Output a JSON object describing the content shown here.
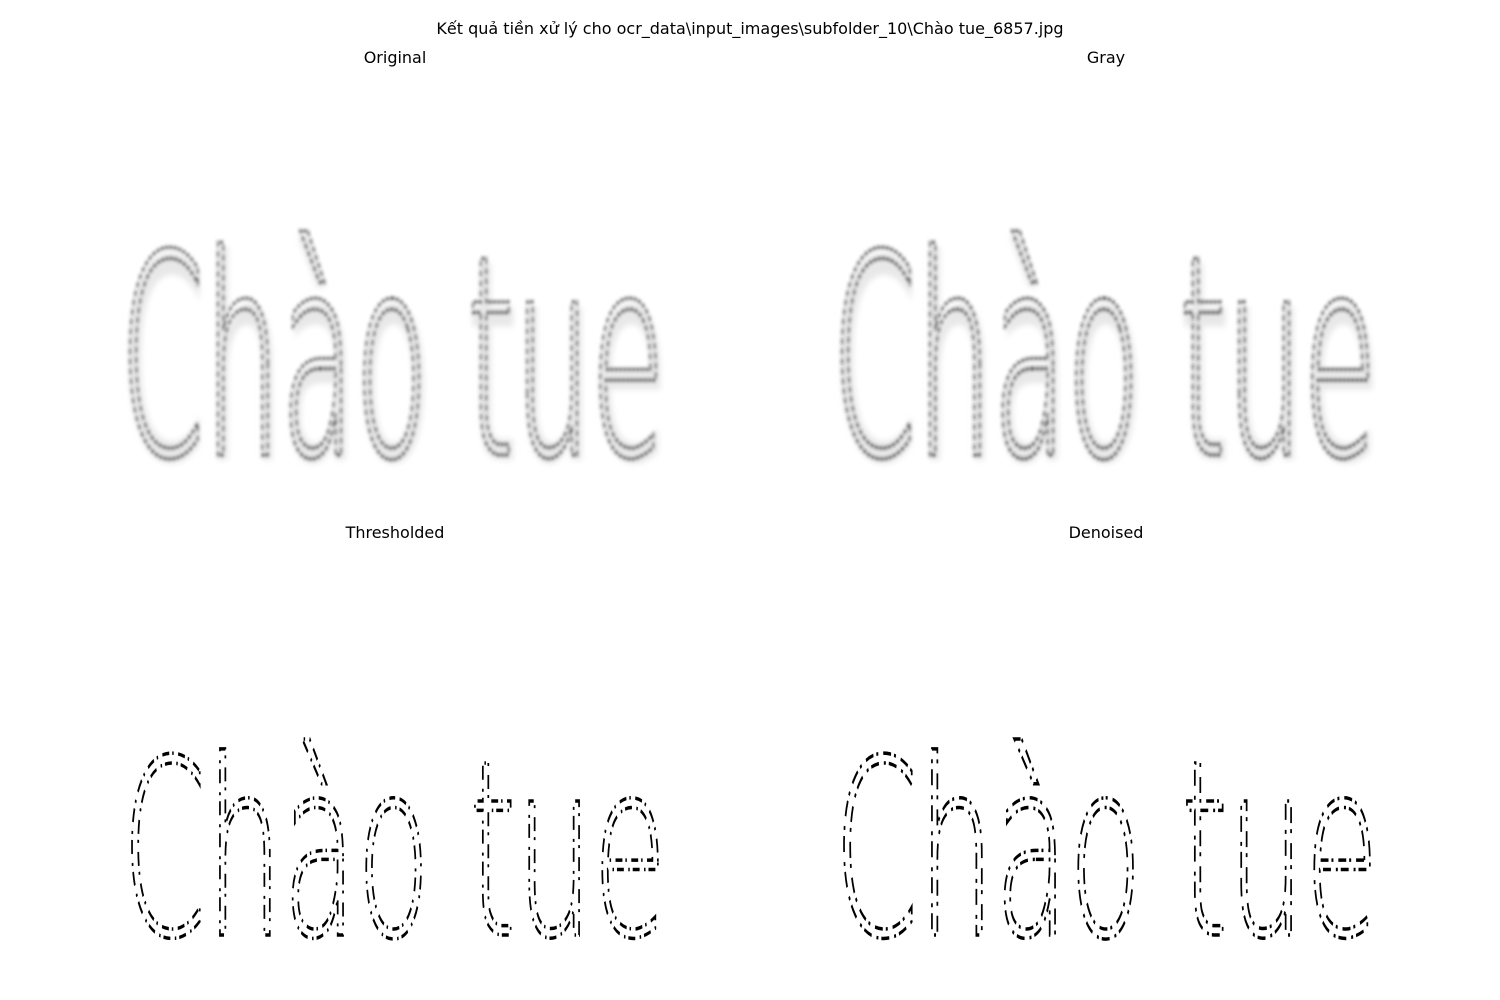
{
  "figure": {
    "suptitle": "Kết quả tiền xử lý cho ocr_data\\input_images\\subfolder_10\\Chào tue_6857.jpg",
    "panels": [
      {
        "id": "original",
        "title": "Original",
        "image_text": "Chào tue",
        "style": "blurred-gray"
      },
      {
        "id": "gray",
        "title": "Gray",
        "image_text": "Chào tue",
        "style": "blurred-gray"
      },
      {
        "id": "thresholded",
        "title": "Thresholded",
        "image_text": "Chào tue",
        "style": "binary"
      },
      {
        "id": "denoised",
        "title": "Denoised",
        "image_text": "Chào tue",
        "style": "binary"
      }
    ]
  }
}
